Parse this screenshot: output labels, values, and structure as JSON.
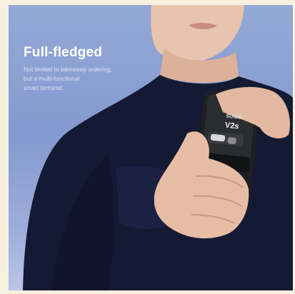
{
  "promo": {
    "headline": "Full-fledged",
    "description_lines": [
      "Not limited to takeaway ordering,",
      "but a multi-functional",
      "smart terminal."
    ]
  },
  "device": {
    "brand": "SUNMI",
    "model": "V2s"
  },
  "colors": {
    "background": "#f7f0de",
    "sky": "#8a9ed2",
    "sweater": "#141a33",
    "device": "#1e1f22"
  }
}
